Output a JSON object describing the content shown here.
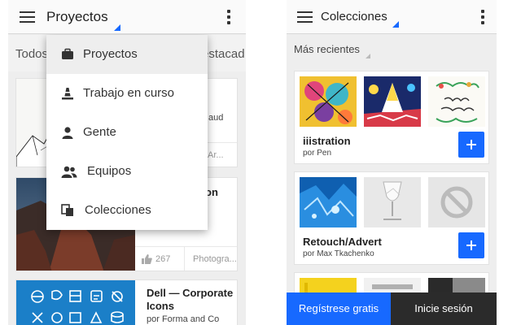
{
  "left": {
    "appbar": {
      "title": "Proyectos"
    },
    "filter": {
      "left": "Todos",
      "right": "estacad"
    },
    "dropdown_menu": {
      "items": [
        {
          "label": "Proyectos",
          "icon": "briefcase-icon",
          "active": true
        },
        {
          "label": "Trabajo en curso",
          "icon": "cone-icon",
          "active": false
        },
        {
          "label": "Gente",
          "icon": "person-icon",
          "active": false
        },
        {
          "label": "Equipos",
          "icon": "people-icon",
          "active": false
        },
        {
          "label": "Colecciones",
          "icon": "collections-icon",
          "active": false
        }
      ]
    },
    "cards": [
      {
        "title_fragment": "aud",
        "footer_fragment": "al Ar..."
      },
      {
        "title_fragment": "on",
        "likes": "267",
        "field": "Photogra..."
      },
      {
        "title": "Dell — Corporate Icons",
        "author": "por Forma and Co"
      }
    ]
  },
  "right": {
    "appbar": {
      "title": "Colecciones"
    },
    "sort": {
      "label": "Más recientes"
    },
    "collections": [
      {
        "title": "iiistration",
        "author": "por Pen"
      },
      {
        "title": "Retouch/Advert",
        "author": "por Max Tkachenko"
      }
    ],
    "buttons": {
      "signup": "Regístrese gratis",
      "login": "Inicie sesión"
    }
  },
  "colors": {
    "accent": "#1769ff",
    "dark_button": "#2b2b2b"
  }
}
